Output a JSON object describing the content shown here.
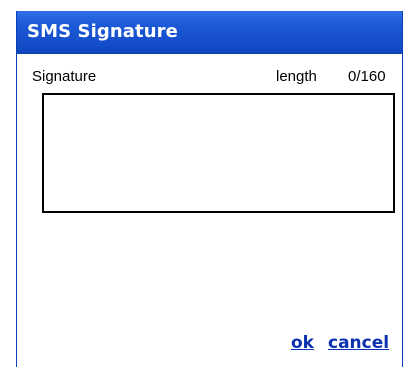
{
  "dialog": {
    "title": "SMS Signature"
  },
  "form": {
    "signature_label": "Signature",
    "length_label": "length",
    "length_count": "0/160",
    "signature_value": ""
  },
  "buttons": {
    "ok_label": "ok",
    "cancel_label": "cancel"
  },
  "colors": {
    "titlebar": "#1d59d6",
    "link": "#0a31b0"
  }
}
